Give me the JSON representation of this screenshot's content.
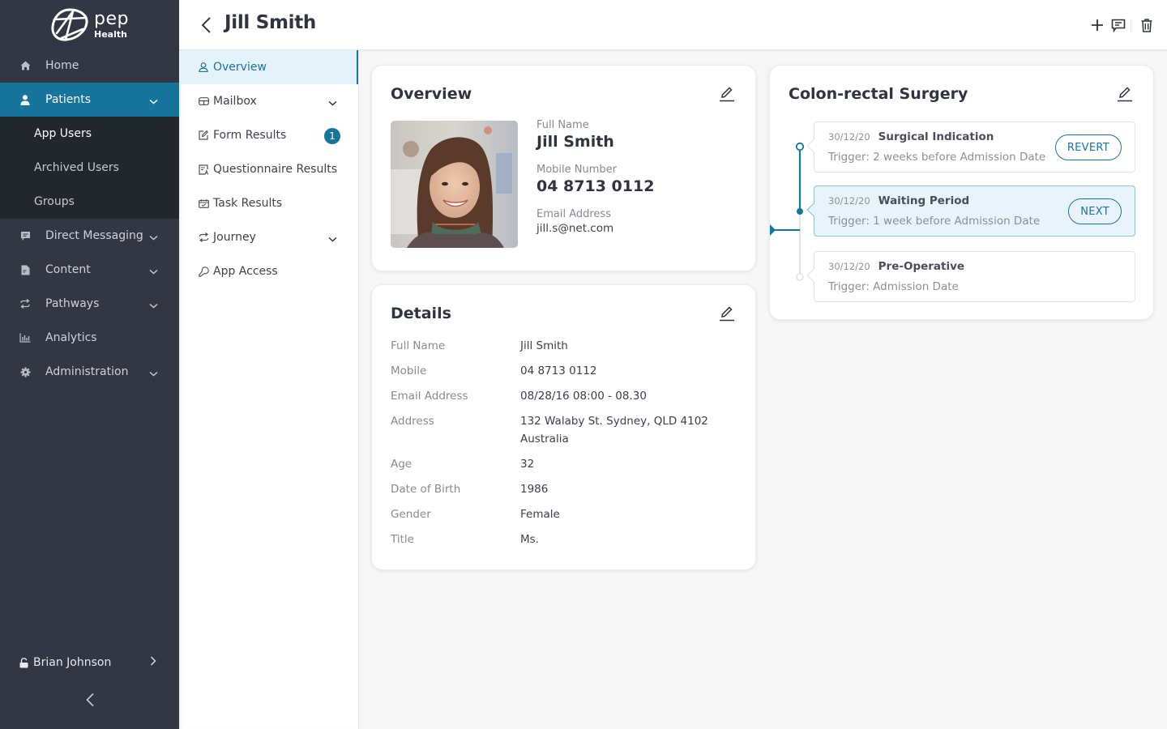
{
  "brand": {
    "name": "pep",
    "sub": "Health",
    "accent": "#17759c",
    "sidebar_bg": "#333743"
  },
  "sidebar": {
    "items": [
      {
        "label": "Home",
        "icon": "home-icon"
      },
      {
        "label": "Patients",
        "icon": "user-icon",
        "active": true,
        "expanded": true,
        "children": [
          {
            "label": "App Users"
          },
          {
            "label": "Archived Users"
          },
          {
            "label": "Groups"
          }
        ]
      },
      {
        "label": "Direct Messaging",
        "icon": "message-icon"
      },
      {
        "label": "Content",
        "icon": "document-icon"
      },
      {
        "label": "Pathways",
        "icon": "repeat-icon"
      },
      {
        "label": "Analytics",
        "icon": "bar-chart-icon"
      },
      {
        "label": "Administration",
        "icon": "gear-icon"
      }
    ],
    "user": {
      "name": "Brian Johnson"
    }
  },
  "header": {
    "title": "Jill Smith"
  },
  "subnav": {
    "items": [
      {
        "label": "Overview",
        "icon": "person-outline-icon",
        "active": true
      },
      {
        "label": "Mailbox",
        "icon": "mailbox-icon"
      },
      {
        "label": "Form Results",
        "icon": "form-edit-icon",
        "badge": "1"
      },
      {
        "label": "Questionnaire Results",
        "icon": "questionnaire-icon"
      },
      {
        "label": "Task Results",
        "icon": "task-icon"
      },
      {
        "label": "Journey",
        "icon": "journey-icon"
      },
      {
        "label": "App Access",
        "icon": "key-icon"
      }
    ]
  },
  "overview": {
    "title": "Overview",
    "full_name_label": "Full Name",
    "full_name": "Jill Smith",
    "mobile_label": "Mobile Number",
    "mobile": "04 8713 0112",
    "email_label": "Email Address",
    "email": "jill.s@net.com"
  },
  "details": {
    "title": "Details",
    "rows": [
      {
        "k": "Full Name",
        "v": "Jill Smith"
      },
      {
        "k": "Mobile",
        "v": "04 8713 0112"
      },
      {
        "k": "Email Address",
        "v": "08/28/16 08:00 - 08.30"
      },
      {
        "k": "Address",
        "v": "132 Walaby St. Sydney, QLD 4102",
        "v2": "Australia"
      },
      {
        "k": "Age",
        "v": "32"
      },
      {
        "k": "Date of Birth",
        "v": "1986"
      },
      {
        "k": "Gender",
        "v": "Female"
      },
      {
        "k": "Title",
        "v": "Ms."
      }
    ]
  },
  "journey": {
    "title": "Colon-rectal Surgery",
    "steps": [
      {
        "date": "30/12/20",
        "name": "Surgical Indication",
        "trigger": "Trigger: 2 weeks before Admission Date",
        "action": "REVERT",
        "state": "completed"
      },
      {
        "date": "30/12/20",
        "name": "Waiting Period",
        "trigger": "Trigger: 1 week before Admission Date",
        "action": "NEXT",
        "state": "current"
      },
      {
        "date": "30/12/20",
        "name": "Pre-Operative",
        "trigger": "Trigger: Admission Date",
        "state": "upcoming"
      }
    ]
  }
}
